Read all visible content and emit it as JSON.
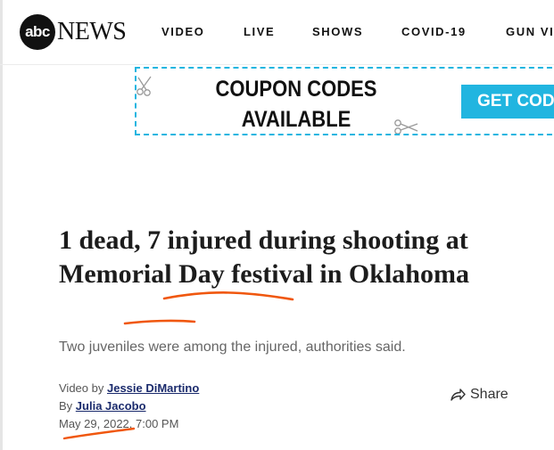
{
  "header": {
    "logo_abc": "abc",
    "logo_news": "NEWS",
    "nav": [
      {
        "label": "VIDEO"
      },
      {
        "label": "LIVE"
      },
      {
        "label": "SHOWS"
      },
      {
        "label": "COVID-19"
      },
      {
        "label": "GUN VI"
      }
    ]
  },
  "ad": {
    "text": "COUPON CODES\nAVAILABLE",
    "button": "GET CODE",
    "accent_color": "#21b5e0",
    "icons": [
      "scissors-icon",
      "scissors-icon"
    ]
  },
  "article": {
    "headline": "1 dead, 7 injured during shooting at Memorial Day festival in Oklahoma",
    "subhead": "Two juveniles were among the injured, authorities said.",
    "video_by_prefix": "Video by",
    "video_by_name": "Jessie DiMartino",
    "by_prefix": "By",
    "author": "Julia Jacobo",
    "date": "May 29, 2022",
    "time": ", 7:00 PM",
    "share_label": "Share",
    "share_icon": "share-arrow-icon"
  },
  "annotation_color": "#f0570e"
}
